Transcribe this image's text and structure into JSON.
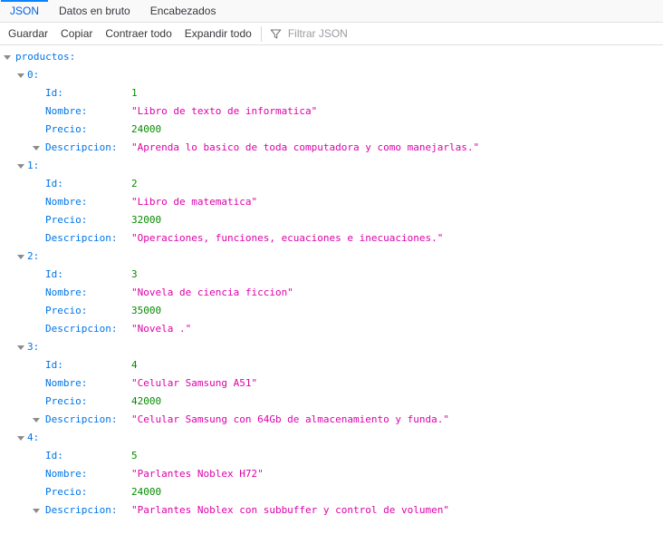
{
  "tabs": {
    "json": "JSON",
    "raw": "Datos en bruto",
    "headers": "Encabezados"
  },
  "toolbar": {
    "save": "Guardar",
    "copy": "Copiar",
    "collapse_all": "Contraer todo",
    "expand_all": "Expandir todo",
    "filter_placeholder": "Filtrar JSON"
  },
  "colors": {
    "accent_blue": "#0a84ff",
    "active_tab_text": "#0060df",
    "key_blue": "#0074e8",
    "number_green": "#058b00",
    "string_magenta": "#dd00a9"
  },
  "tree": {
    "root_label": "productos:",
    "products": [
      {
        "index_label": "0:",
        "properties": [
          {
            "key": "Id:",
            "value": "1",
            "kind": "number",
            "expandable": false
          },
          {
            "key": "Nombre:",
            "value": "\"Libro de texto de informatica\"",
            "kind": "string",
            "expandable": false
          },
          {
            "key": "Precio:",
            "value": "24000",
            "kind": "number",
            "expandable": false
          },
          {
            "key": "Descripcion:",
            "value": "\"Aprenda lo basico de toda computadora y como manejarlas.\"",
            "kind": "string",
            "expandable": true
          }
        ]
      },
      {
        "index_label": "1:",
        "properties": [
          {
            "key": "Id:",
            "value": "2",
            "kind": "number",
            "expandable": false
          },
          {
            "key": "Nombre:",
            "value": "\"Libro de matematica\"",
            "kind": "string",
            "expandable": false
          },
          {
            "key": "Precio:",
            "value": "32000",
            "kind": "number",
            "expandable": false
          },
          {
            "key": "Descripcion:",
            "value": "\"Operaciones, funciones, ecuaciones e inecuaciones.\"",
            "kind": "string",
            "expandable": false
          }
        ]
      },
      {
        "index_label": "2:",
        "properties": [
          {
            "key": "Id:",
            "value": "3",
            "kind": "number",
            "expandable": false
          },
          {
            "key": "Nombre:",
            "value": "\"Novela de ciencia ficcion\"",
            "kind": "string",
            "expandable": false
          },
          {
            "key": "Precio:",
            "value": "35000",
            "kind": "number",
            "expandable": false
          },
          {
            "key": "Descripcion:",
            "value": "\"Novela .\"",
            "kind": "string",
            "expandable": false
          }
        ]
      },
      {
        "index_label": "3:",
        "properties": [
          {
            "key": "Id:",
            "value": "4",
            "kind": "number",
            "expandable": false
          },
          {
            "key": "Nombre:",
            "value": "\"Celular Samsung A51\"",
            "kind": "string",
            "expandable": false
          },
          {
            "key": "Precio:",
            "value": "42000",
            "kind": "number",
            "expandable": false
          },
          {
            "key": "Descripcion:",
            "value": "\"Celular Samsung con 64Gb de almacenamiento y funda.\"",
            "kind": "string",
            "expandable": true
          }
        ]
      },
      {
        "index_label": "4:",
        "properties": [
          {
            "key": "Id:",
            "value": "5",
            "kind": "number",
            "expandable": false
          },
          {
            "key": "Nombre:",
            "value": "\"Parlantes Noblex H72\"",
            "kind": "string",
            "expandable": false
          },
          {
            "key": "Precio:",
            "value": "24000",
            "kind": "number",
            "expandable": false
          },
          {
            "key": "Descripcion:",
            "value": "\"Parlantes Noblex con subbuffer y control de volumen\"",
            "kind": "string",
            "expandable": true
          }
        ]
      }
    ]
  }
}
